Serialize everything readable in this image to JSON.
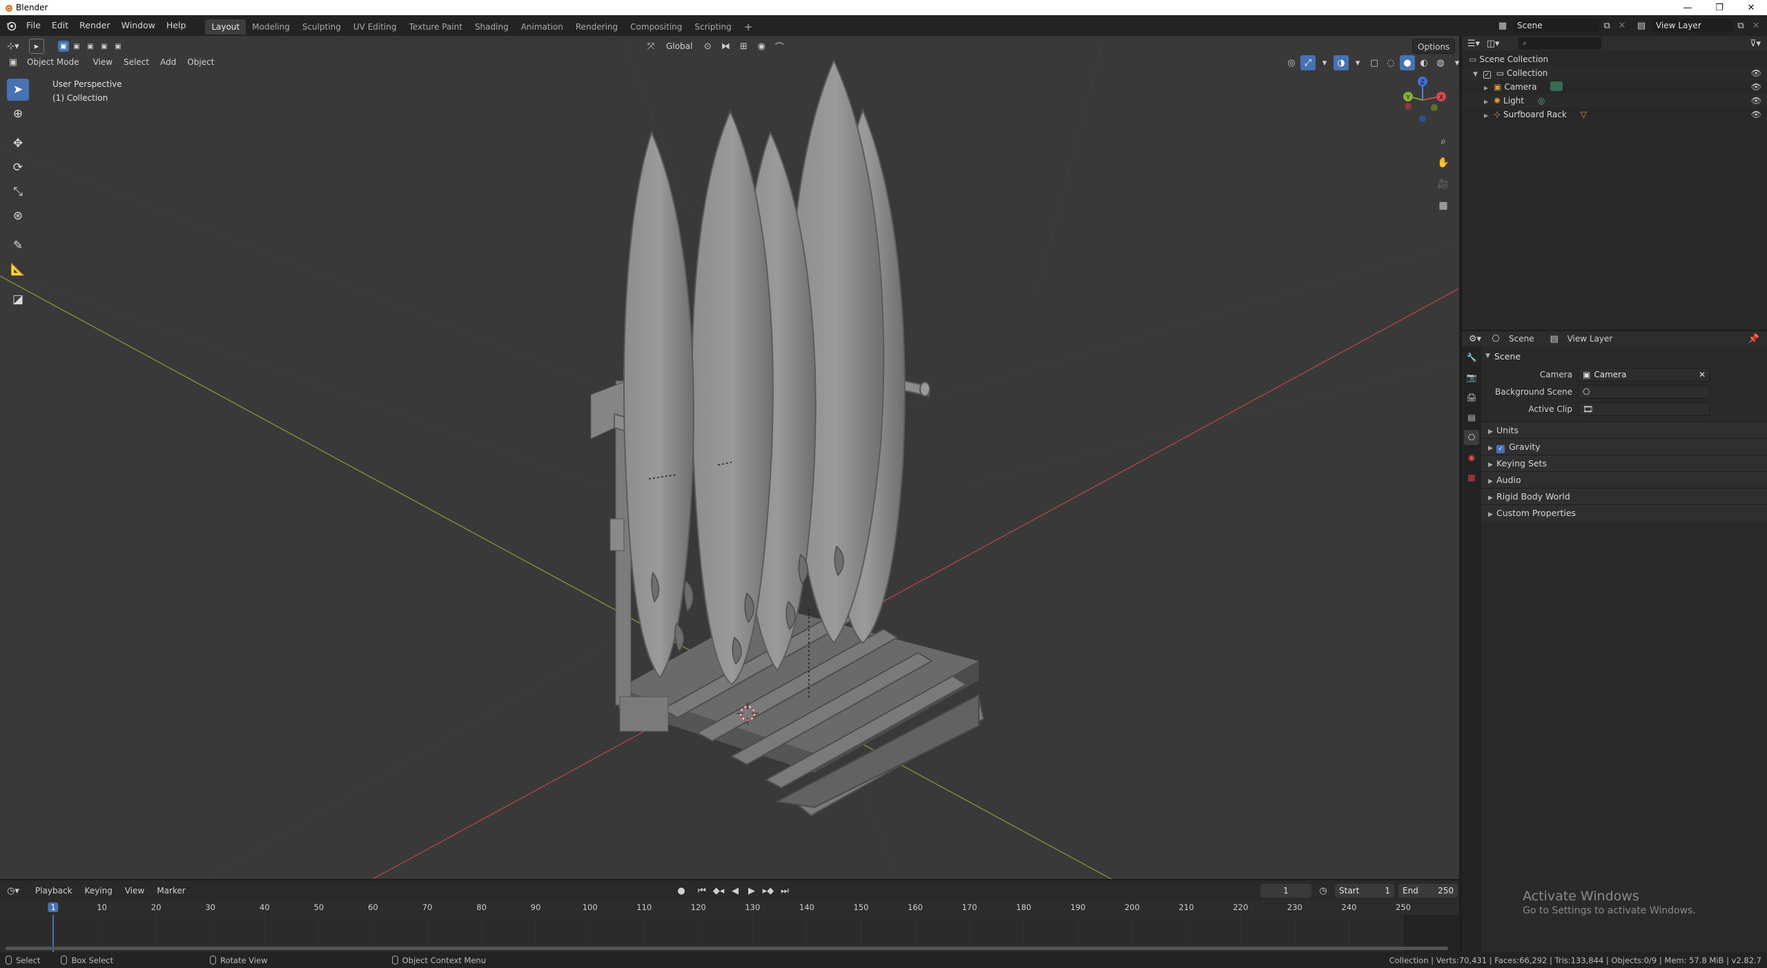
{
  "window": {
    "title": "Blender",
    "minimize": "—",
    "maximize": "❐",
    "close": "✕"
  },
  "menu": [
    "File",
    "Edit",
    "Render",
    "Window",
    "Help"
  ],
  "workspaces": [
    "Layout",
    "Modeling",
    "Sculpting",
    "UV Editing",
    "Texture Paint",
    "Shading",
    "Animation",
    "Rendering",
    "Compositing",
    "Scripting"
  ],
  "workspace_add": "+",
  "scene_selector": {
    "scene": "Scene",
    "view_layer": "View Layer"
  },
  "viewport": {
    "orientation": "Global",
    "options_label": "Options",
    "mode": "Object Mode",
    "menus": [
      "View",
      "Select",
      "Add",
      "Object"
    ],
    "overlay_title": "User Perspective",
    "overlay_collection": "(1) Collection",
    "gizmo": {
      "x": "X",
      "y": "Y",
      "z": "Z"
    }
  },
  "outliner": {
    "search_placeholder": "",
    "root": "Scene Collection",
    "collection": "Collection",
    "items": [
      "Camera",
      "Light",
      "Surfboard Rack"
    ]
  },
  "properties": {
    "breadcrumb": {
      "scene": "Scene",
      "view_layer": "View Layer"
    },
    "panel_title": "Scene",
    "fields": [
      {
        "label": "Camera",
        "value": "Camera"
      },
      {
        "label": "Background Scene",
        "value": ""
      },
      {
        "label": "Active Clip",
        "value": ""
      }
    ],
    "subpanels": [
      "Units",
      "Gravity",
      "Keying Sets",
      "Audio",
      "Rigid Body World",
      "Custom Properties"
    ],
    "gravity_checked": true
  },
  "timeline": {
    "menus": [
      "Playback",
      "Keying",
      "View",
      "Marker"
    ],
    "current_frame": "1",
    "start_label": "Start",
    "start": "1",
    "end_label": "End",
    "end": "250",
    "ticks": [
      "1",
      "10",
      "20",
      "30",
      "40",
      "50",
      "60",
      "70",
      "80",
      "90",
      "100",
      "110",
      "120",
      "130",
      "140",
      "150",
      "160",
      "170",
      "180",
      "190",
      "200",
      "210",
      "220",
      "230",
      "240",
      "250"
    ]
  },
  "status": {
    "left": [
      "Select",
      "Box Select",
      "Rotate View",
      "Object Context Menu"
    ],
    "right": "Collection | Verts:70,431 | Faces:66,292 | Tris:133,844 | Objects:0/9 | Mem: 57.8 MiB | v2.82.7"
  },
  "watermark": {
    "title": "Activate Windows",
    "subtitle": "Go to Settings to activate Windows."
  },
  "colors": {
    "accent": "#4772b3",
    "viewport_bg": "#393939",
    "x_axis": "#c24a4a",
    "y_axis": "#8ea33b"
  }
}
